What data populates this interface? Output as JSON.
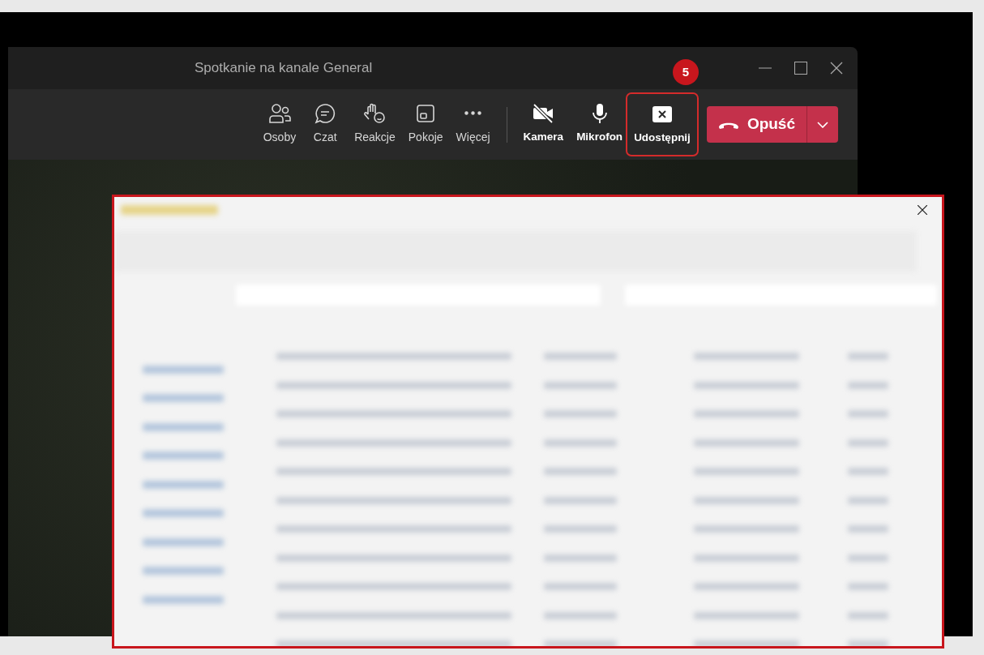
{
  "window": {
    "title": "Spotkanie na kanale General"
  },
  "toolbar": [
    {
      "label": "Osoby",
      "kind": "people",
      "emphasized": false,
      "highlighted": false
    },
    {
      "label": "Czat",
      "kind": "chat",
      "emphasized": false,
      "highlighted": false
    },
    {
      "label": "Reakcje",
      "kind": "reactions",
      "emphasized": false,
      "highlighted": false
    },
    {
      "label": "Pokoje",
      "kind": "rooms",
      "emphasized": false,
      "highlighted": false
    },
    {
      "label": "Więcej",
      "kind": "more",
      "emphasized": false,
      "highlighted": false
    },
    {
      "label": "Kamera",
      "kind": "camera",
      "emphasized": true,
      "highlighted": false
    },
    {
      "label": "Mikrofon",
      "kind": "mic",
      "emphasized": true,
      "highlighted": false
    },
    {
      "label": "Udostępnij",
      "kind": "share",
      "emphasized": true,
      "highlighted": true
    }
  ],
  "step_badge": "5",
  "leave_button": {
    "label": "Opuść"
  }
}
